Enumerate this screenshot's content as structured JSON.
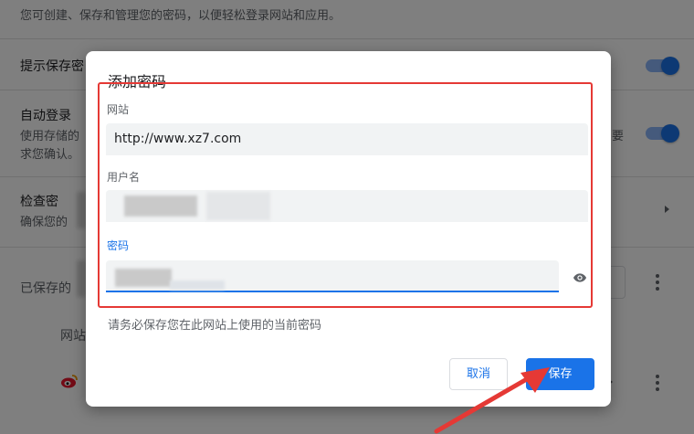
{
  "background": {
    "description": "您可创建、保存和管理您的密码，以便轻松登录网站和应用。",
    "rows": [
      {
        "title": "提示保存密"
      },
      {
        "title": "自动登录",
        "sub": "使用存储的",
        "sub2": "求您确认。",
        "right_text": "要"
      },
      {
        "title": "检查密",
        "sub": "确保您的"
      }
    ],
    "saved_label": "已保存的",
    "site_label": "网站"
  },
  "dialog": {
    "title": "添加密码",
    "website_label": "网站",
    "website_value": "http://www.xz7.com",
    "username_label": "用户名",
    "password_label": "密码",
    "hint": "请务必保存您在此网站上使用的当前密码",
    "cancel_label": "取消",
    "save_label": "保存"
  },
  "icons": {
    "eye": "eye-icon",
    "site_favicon": "weibo-icon"
  },
  "colors": {
    "accent": "#1a73e8",
    "annotation": "#e53935"
  }
}
